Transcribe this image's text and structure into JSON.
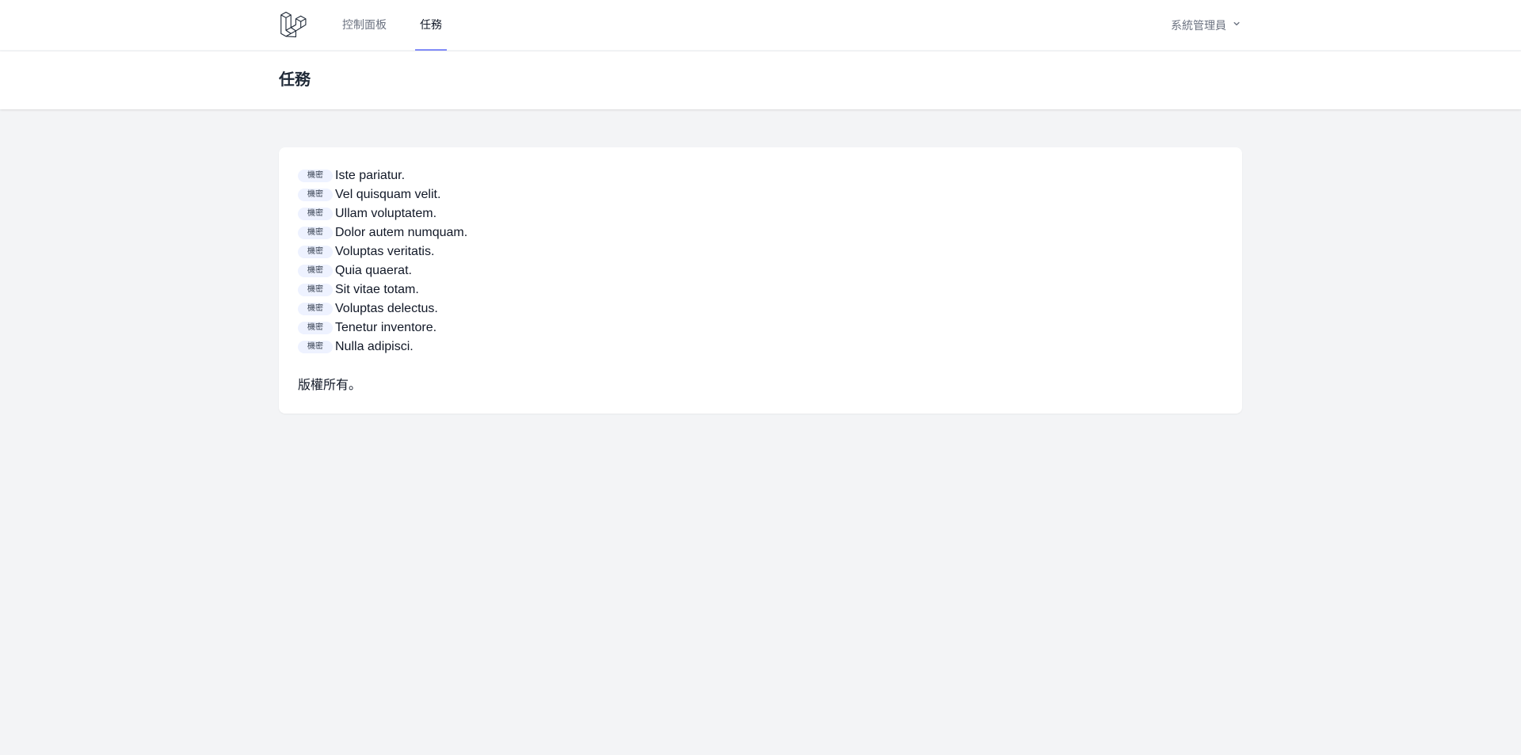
{
  "nav": {
    "dashboard_label": "控制面板",
    "tasks_label": "任務",
    "user_name": "系統管理員"
  },
  "header": {
    "title": "任務"
  },
  "tasks": [
    {
      "badge": "機密",
      "title": "Iste pariatur."
    },
    {
      "badge": "機密",
      "title": "Vel quisquam velit."
    },
    {
      "badge": "機密",
      "title": "Ullam voluptatem."
    },
    {
      "badge": "機密",
      "title": "Dolor autem numquam."
    },
    {
      "badge": "機密",
      "title": "Voluptas veritatis."
    },
    {
      "badge": "機密",
      "title": "Quia quaerat."
    },
    {
      "badge": "機密",
      "title": "Sit vitae totam."
    },
    {
      "badge": "機密",
      "title": "Voluptas delectus."
    },
    {
      "badge": "機密",
      "title": "Tenetur inventore."
    },
    {
      "badge": "機密",
      "title": "Nulla adipisci."
    }
  ],
  "footer": {
    "text": "版權所有。"
  },
  "colors": {
    "accent": "#818cf8",
    "badge_bg": "#eef2ff",
    "page_bg": "#f3f4f6"
  },
  "icons": {
    "logo": "laravel-logo-icon",
    "dropdown": "chevron-down-icon"
  }
}
